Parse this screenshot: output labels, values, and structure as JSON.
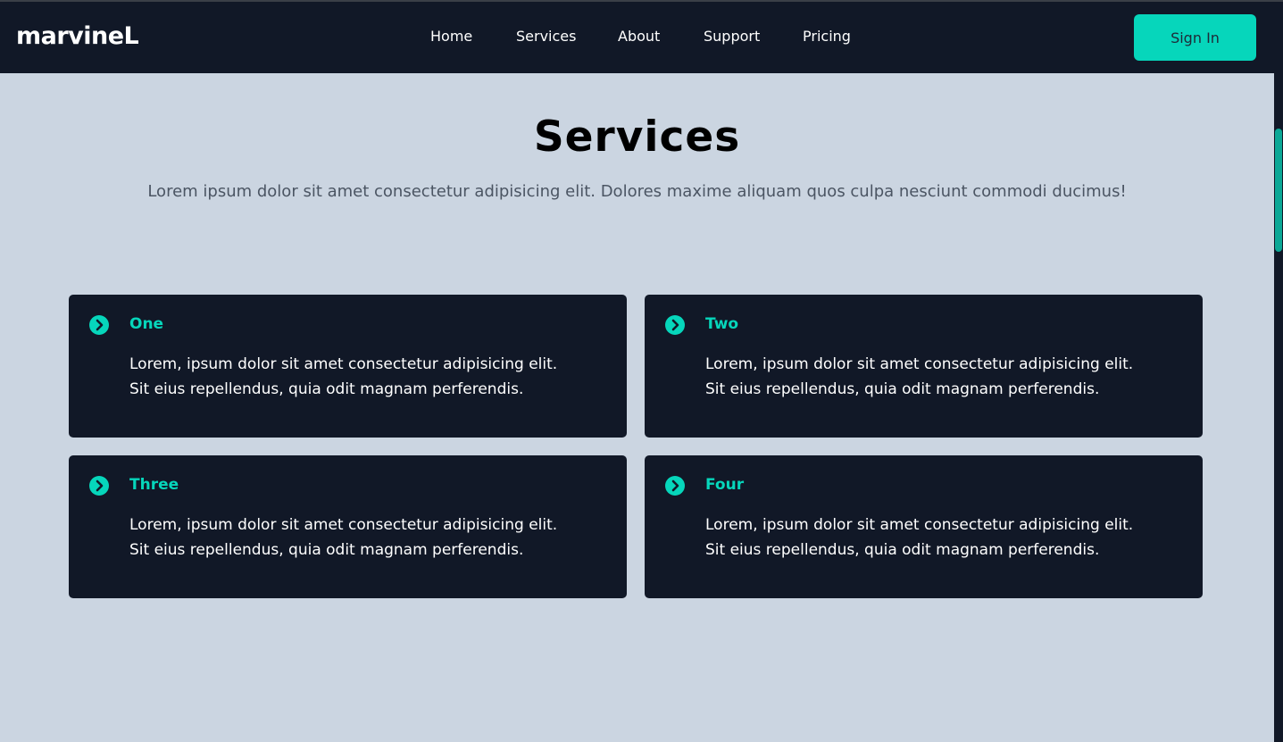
{
  "brand": "marvineL",
  "nav": {
    "links": [
      "Home",
      "Services",
      "About",
      "Support",
      "Pricing"
    ],
    "sign_in": "Sign In"
  },
  "section": {
    "title": "Services",
    "subtitle": "Lorem ipsum dolor sit amet consectetur adipisicing elit. Dolores maxime aliquam quos culpa nesciunt commodi ducimus!"
  },
  "cards": [
    {
      "title": "One",
      "text": "Lorem, ipsum dolor sit amet consectetur adipisicing elit. Sit eius repellendus, quia odit magnam perferendis.",
      "icon": "chevron-circle-right-icon"
    },
    {
      "title": "Two",
      "text": "Lorem, ipsum dolor sit amet consectetur adipisicing elit. Sit eius repellendus, quia odit magnam perferendis.",
      "icon": "chevron-circle-right-icon"
    },
    {
      "title": "Three",
      "text": "Lorem, ipsum dolor sit amet consectetur adipisicing elit. Sit eius repellendus, quia odit magnam perferendis.",
      "icon": "chevron-circle-right-icon"
    },
    {
      "title": "Four",
      "text": "Lorem, ipsum dolor sit amet consectetur adipisicing elit. Sit eius repellendus, quia odit magnam perferendis.",
      "icon": "chevron-circle-right-icon"
    }
  ],
  "colors": {
    "accent": "#06d6bb",
    "dark": "#111827",
    "background": "#cbd5e1"
  }
}
